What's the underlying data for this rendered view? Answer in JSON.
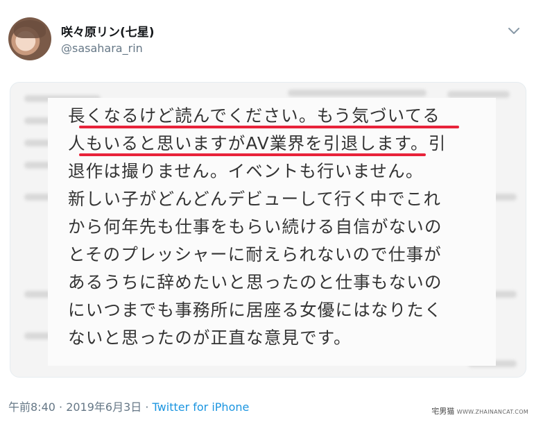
{
  "tweet": {
    "display_name": "咲々原リン(七星)",
    "handle": "@sasahara_rin",
    "image_text_lines": [
      "長くなるけど読んでください。もう気づいてる",
      "人もいると思いますがAV業界を引退します。引",
      "退作は撮りません。イベントも行いません。",
      "新しい子がどんどんデビューして行く中でこれ",
      "から何年先も仕事をもらい続ける自信がないの",
      "とそのプレッシャーに耐えられないので仕事が",
      "あるうちに辞めたいと思ったのと仕事もないの",
      "にいつまでも事務所に居座る女優にはなりたく",
      "ないと思ったのが正直な意見です。"
    ],
    "timestamp": "午前8:40 · 2019年6月3日 · ",
    "source": "Twitter for iPhone"
  },
  "watermark": {
    "site": "宅男猫",
    "url": "WWW.ZHAINANCAT.COM"
  },
  "colors": {
    "highlight": "#e8233a",
    "link": "#1b95e0",
    "muted": "#657786"
  },
  "icons": {
    "menu": "chevron-down-icon",
    "avatar": "profile-photo"
  }
}
